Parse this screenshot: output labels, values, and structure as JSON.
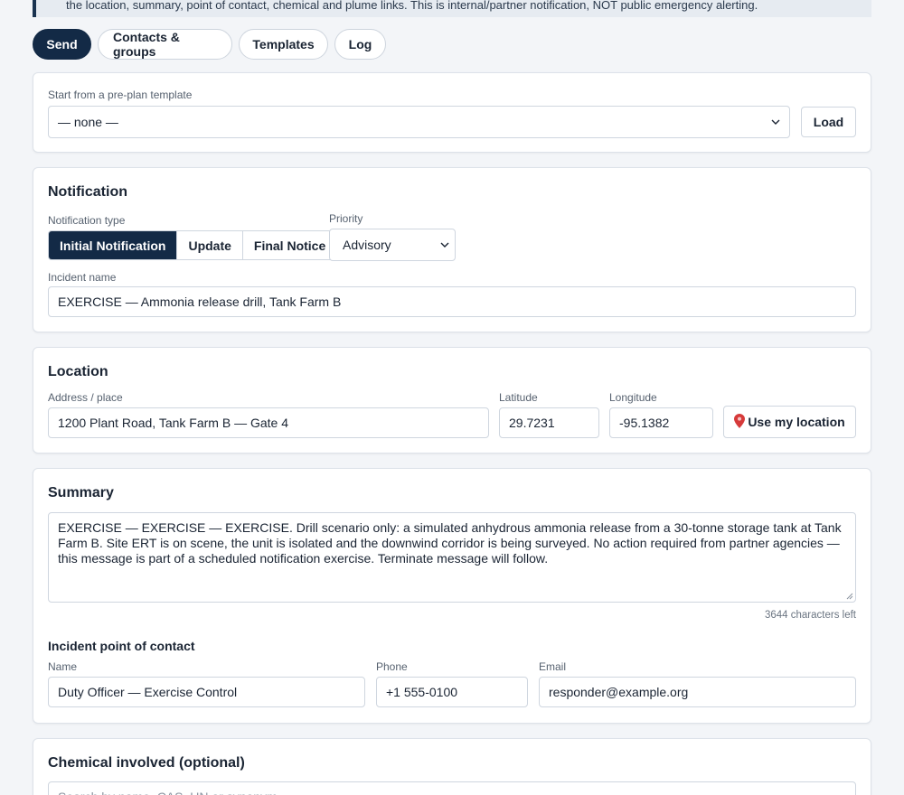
{
  "notice": {
    "text": "the location, summary, point of contact, chemical and plume links. This is internal/partner notification, NOT public emergency alerting."
  },
  "tabs": [
    {
      "label": "Send",
      "active": true
    },
    {
      "label": "Contacts & groups",
      "active": false
    },
    {
      "label": "Templates",
      "active": false
    },
    {
      "label": "Log",
      "active": false
    }
  ],
  "preplan": {
    "label": "Start from a pre-plan template",
    "selected": "— none —",
    "load_label": "Load"
  },
  "notification": {
    "heading": "Notification",
    "type_label": "Notification type",
    "types": [
      "Initial Notification",
      "Update",
      "Final Notice"
    ],
    "active_type": "Initial Notification",
    "priority_label": "Priority",
    "priority_value": "Advisory",
    "incident_label": "Incident name",
    "incident_value": "EXERCISE — Ammonia release drill, Tank Farm B"
  },
  "location": {
    "heading": "Location",
    "address_label": "Address / place",
    "address_value": "1200 Plant Road, Tank Farm B — Gate 4",
    "lat_label": "Latitude",
    "lat_value": "29.7231",
    "lon_label": "Longitude",
    "lon_value": "-95.1382",
    "use_location_label": "Use my location"
  },
  "summary": {
    "heading": "Summary",
    "text": "EXERCISE — EXERCISE — EXERCISE. Drill scenario only: a simulated anhydrous ammonia release from a 30-tonne storage tank at Tank Farm B. Site ERT is on scene, the unit is isolated and the downwind corridor is being surveyed. No action required from partner agencies — this message is part of a scheduled notification exercise. Terminate message will follow.",
    "chars_left": "3644 characters left"
  },
  "contact": {
    "heading": "Incident point of contact",
    "name_label": "Name",
    "name_value": "Duty Officer — Exercise Control",
    "phone_label": "Phone",
    "phone_value": "+1 555-0100",
    "email_label": "Email",
    "email_value": "responder@example.org"
  },
  "chemical": {
    "heading": "Chemical involved (optional)",
    "search_placeholder": "Search by name, CAS, UN or synonym"
  },
  "colors": {
    "accent": "#132a46",
    "background": "#f3f5f8",
    "pin": "#d63a3a"
  }
}
